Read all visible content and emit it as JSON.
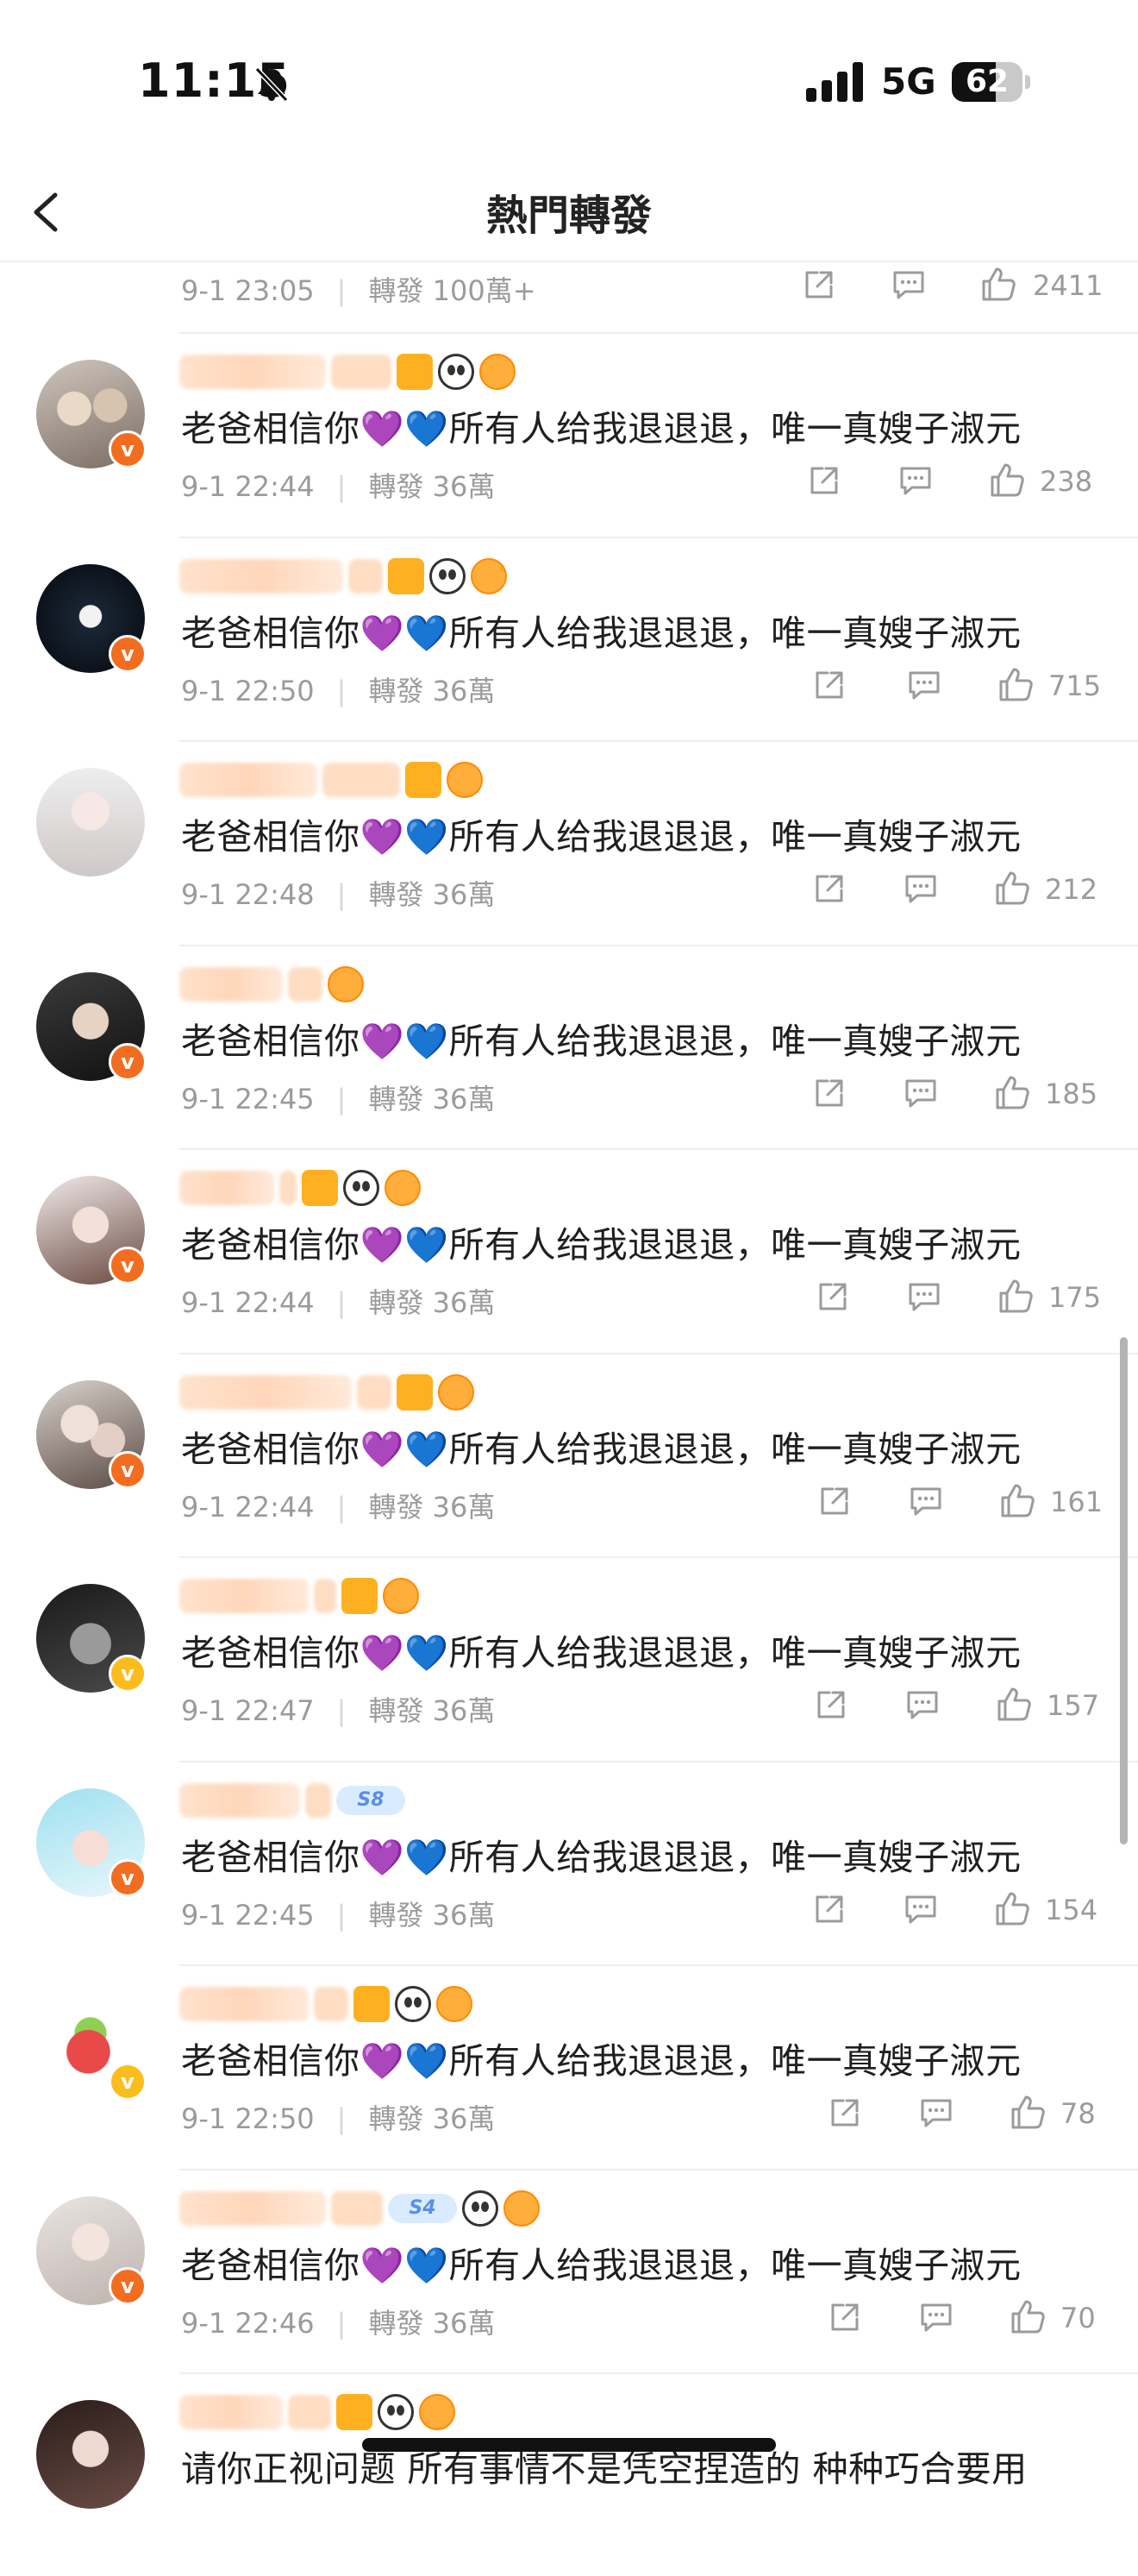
{
  "status_bar": {
    "time": "11:15",
    "network": "5G",
    "battery_text": "62",
    "battery_level": 0.62
  },
  "nav": {
    "title": "熱門轉發"
  },
  "labels": {
    "repost": "轉發"
  },
  "colors": {
    "accent_orange": "#ff8200",
    "badge_orange": "#f36d20",
    "badge_yellow": "#fbbd1e",
    "meta_gray": "#9b9b9b"
  },
  "previous_row": {
    "time": "9-1 23:05",
    "reposts": "100萬+",
    "likes": "2411"
  },
  "rows": [
    {
      "time": "9-1 22:44",
      "reposts": "36萬",
      "likes": "238",
      "badge": "orange",
      "message": "老爸相信你💜💙所有人给我退退退，唯一真嫂子淑元"
    },
    {
      "time": "9-1 22:50",
      "reposts": "36萬",
      "likes": "715",
      "badge": "orange",
      "message": "老爸相信你💜💙所有人给我退退退，唯一真嫂子淑元"
    },
    {
      "time": "9-1 22:48",
      "reposts": "36萬",
      "likes": "212",
      "badge": "none",
      "message": "老爸相信你💜💙所有人给我退退退，唯一真嫂子淑元"
    },
    {
      "time": "9-1 22:45",
      "reposts": "36萬",
      "likes": "185",
      "badge": "orange",
      "message": "老爸相信你💜💙所有人给我退退退，唯一真嫂子淑元"
    },
    {
      "time": "9-1 22:44",
      "reposts": "36萬",
      "likes": "175",
      "badge": "orange",
      "message": "老爸相信你💜💙所有人给我退退退，唯一真嫂子淑元"
    },
    {
      "time": "9-1 22:44",
      "reposts": "36萬",
      "likes": "161",
      "badge": "orange",
      "message": "老爸相信你💜💙所有人给我退退退，唯一真嫂子淑元"
    },
    {
      "time": "9-1 22:47",
      "reposts": "36萬",
      "likes": "157",
      "badge": "yellow",
      "message": "老爸相信你💜💙所有人给我退退退，唯一真嫂子淑元"
    },
    {
      "time": "9-1 22:45",
      "reposts": "36萬",
      "likes": "154",
      "badge": "orange",
      "message": "老爸相信你💜💙所有人给我退退退，唯一真嫂子淑元"
    },
    {
      "time": "9-1 22:50",
      "reposts": "36萬",
      "likes": "78",
      "badge": "yellow",
      "message": "老爸相信你💜💙所有人给我退退退，唯一真嫂子淑元"
    },
    {
      "time": "9-1 22:46",
      "reposts": "36萬",
      "likes": "70",
      "badge": "orange",
      "message": "老爸相信你💜💙所有人给我退退退，唯一真嫂子淑元"
    },
    {
      "time": "",
      "reposts": "",
      "likes": "",
      "badge": "none",
      "message": "请你正视问题 所有事情不是凭空捏造的 种种巧合要用"
    }
  ]
}
